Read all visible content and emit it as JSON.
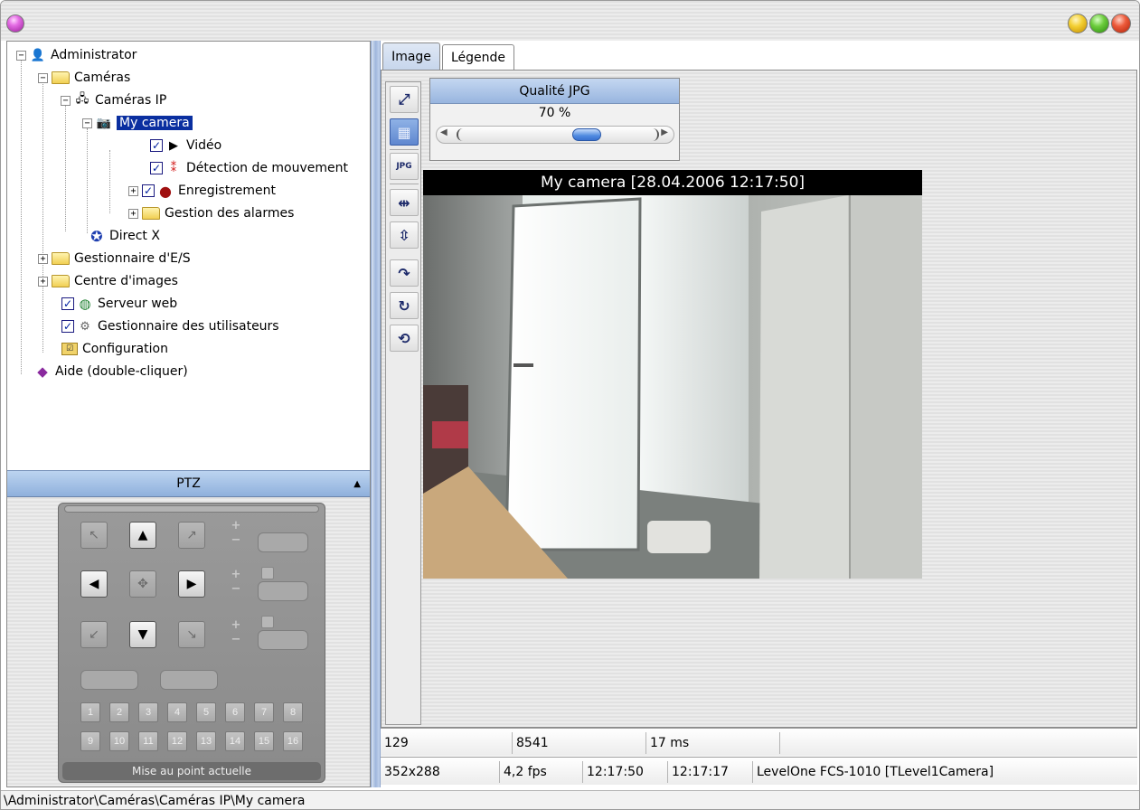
{
  "tree": {
    "administrator": "Administrator",
    "cameras": "Caméras",
    "cameras_ip": "Caméras IP",
    "my_camera": "My camera",
    "video": "Vidéo",
    "motion_detection": "Détection de mouvement",
    "recording": "Enregistrement",
    "alarm_management": "Gestion des alarmes",
    "direct_x": "Direct X",
    "io_manager": "Gestionnaire d'E/S",
    "image_center": "Centre d'images",
    "web_server": "Serveur web",
    "user_manager": "Gestionnaire des utilisateurs",
    "configuration": "Configuration",
    "help": "Aide (double-cliquer)"
  },
  "ptz": {
    "title": "PTZ",
    "presets": [
      "1",
      "2",
      "3",
      "4",
      "5",
      "6",
      "7",
      "8",
      "9",
      "10",
      "11",
      "12",
      "13",
      "14",
      "15",
      "16"
    ],
    "focus_label": "Mise au point actuelle",
    "plus": "+",
    "minus": "−"
  },
  "tabs": {
    "image": "Image",
    "legend": "Légende"
  },
  "jpg": {
    "title": "Qualité JPG",
    "value": "70 %",
    "quality_fraction": 0.7
  },
  "camera": {
    "caption": "My camera [28.04.2006 12:17:50]"
  },
  "status": {
    "row1": [
      "129",
      "8541",
      "17 ms",
      ""
    ],
    "row2": [
      "352x288",
      "4,2 fps",
      "12:17:50",
      "12:17:17",
      "LevelOne FCS-1010 [TLevel1Camera]"
    ]
  },
  "path": "\\Administrator\\Caméras\\Caméras IP\\My camera",
  "colors": {
    "selection": "#0a2fa0",
    "header_blue": "#98b5df",
    "splitter_blue": "#9fb6dc"
  }
}
